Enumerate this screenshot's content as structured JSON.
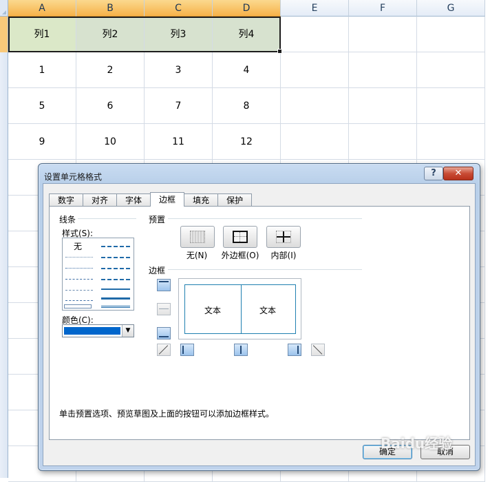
{
  "sheet": {
    "columns": [
      "A",
      "B",
      "C",
      "D",
      "E",
      "F",
      "G"
    ],
    "rows": [
      [
        "列1",
        "列2",
        "列3",
        "列4",
        "",
        "",
        ""
      ],
      [
        "1",
        "2",
        "3",
        "4",
        "",
        "",
        ""
      ],
      [
        "5",
        "6",
        "7",
        "8",
        "",
        "",
        ""
      ],
      [
        "9",
        "10",
        "11",
        "12",
        "",
        "",
        ""
      ],
      [
        "",
        "",
        "",
        "",
        "",
        "",
        ""
      ],
      [
        "",
        "",
        "",
        "",
        "",
        "",
        ""
      ],
      [
        "",
        "",
        "",
        "",
        "",
        "",
        ""
      ],
      [
        "",
        "",
        "",
        "",
        "",
        "",
        ""
      ],
      [
        "",
        "",
        "",
        "",
        "",
        "",
        ""
      ],
      [
        "",
        "",
        "",
        "",
        "",
        "",
        ""
      ],
      [
        "",
        "",
        "",
        "",
        "",
        "",
        ""
      ],
      [
        "",
        "",
        "",
        "",
        "",
        "",
        ""
      ],
      [
        "",
        "",
        "",
        "",
        "",
        "",
        ""
      ]
    ]
  },
  "dialog": {
    "title": "设置单元格格式",
    "help_label": "?",
    "close_label": "✕",
    "tabs": [
      {
        "label": "数字",
        "active": false
      },
      {
        "label": "对齐",
        "active": false
      },
      {
        "label": "字体",
        "active": false
      },
      {
        "label": "边框",
        "active": true
      },
      {
        "label": "填充",
        "active": false
      },
      {
        "label": "保护",
        "active": false
      }
    ],
    "lines": {
      "group_title": "线条",
      "style_label": "样式(S):",
      "none_label": "无",
      "color_label": "颜色(C):",
      "color_value": "#0066cc"
    },
    "presets": {
      "title": "预置",
      "items": [
        {
          "label": "无(N)",
          "icon": "preset-none-icon"
        },
        {
          "label": "外边框(O)",
          "icon": "preset-outline-icon"
        },
        {
          "label": "内部(I)",
          "icon": "preset-inside-icon"
        }
      ]
    },
    "border": {
      "title": "边框",
      "preview_text": "文本"
    },
    "hint": "单击预置选项、预览草图及上面的按钮可以添加边框样式。",
    "ok_label": "确定",
    "cancel_label": "取消"
  },
  "watermark": "Baidu经验",
  "colors": {
    "selected_header": "#f6b24a",
    "line_color": "#0066cc",
    "header_fill": "#d7e2cf"
  }
}
